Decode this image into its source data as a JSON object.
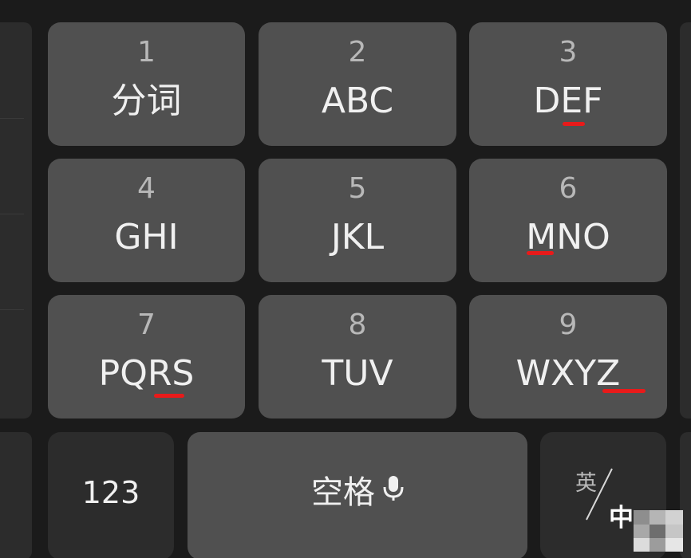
{
  "keyboard": {
    "mode": "chinese-t9",
    "keys": [
      {
        "number": "1",
        "letters": "分词"
      },
      {
        "number": "2",
        "letters": "ABC"
      },
      {
        "number": "3",
        "letters": "DEF"
      },
      {
        "number": "4",
        "letters": "GHI"
      },
      {
        "number": "5",
        "letters": "JKL"
      },
      {
        "number": "6",
        "letters": "MNO"
      },
      {
        "number": "7",
        "letters": "PQRS"
      },
      {
        "number": "8",
        "letters": "TUV"
      },
      {
        "number": "9",
        "letters": "WXYZ"
      }
    ],
    "bottom_row": {
      "numeric_switch_label": "123",
      "space_label": "空格",
      "space_icon": "microphone-icon",
      "lang_toggle_en": "英",
      "lang_toggle_zh": "中"
    }
  },
  "annotations": {
    "underline_color": "#e81a1a",
    "underlined_keys": [
      "DEF",
      "MNO",
      "PQRS",
      "WXYZ"
    ]
  },
  "colors": {
    "background": "#1b1b1b",
    "key": "#505050",
    "function_key": "#2c2c2c",
    "text": "#f0f0f0"
  }
}
